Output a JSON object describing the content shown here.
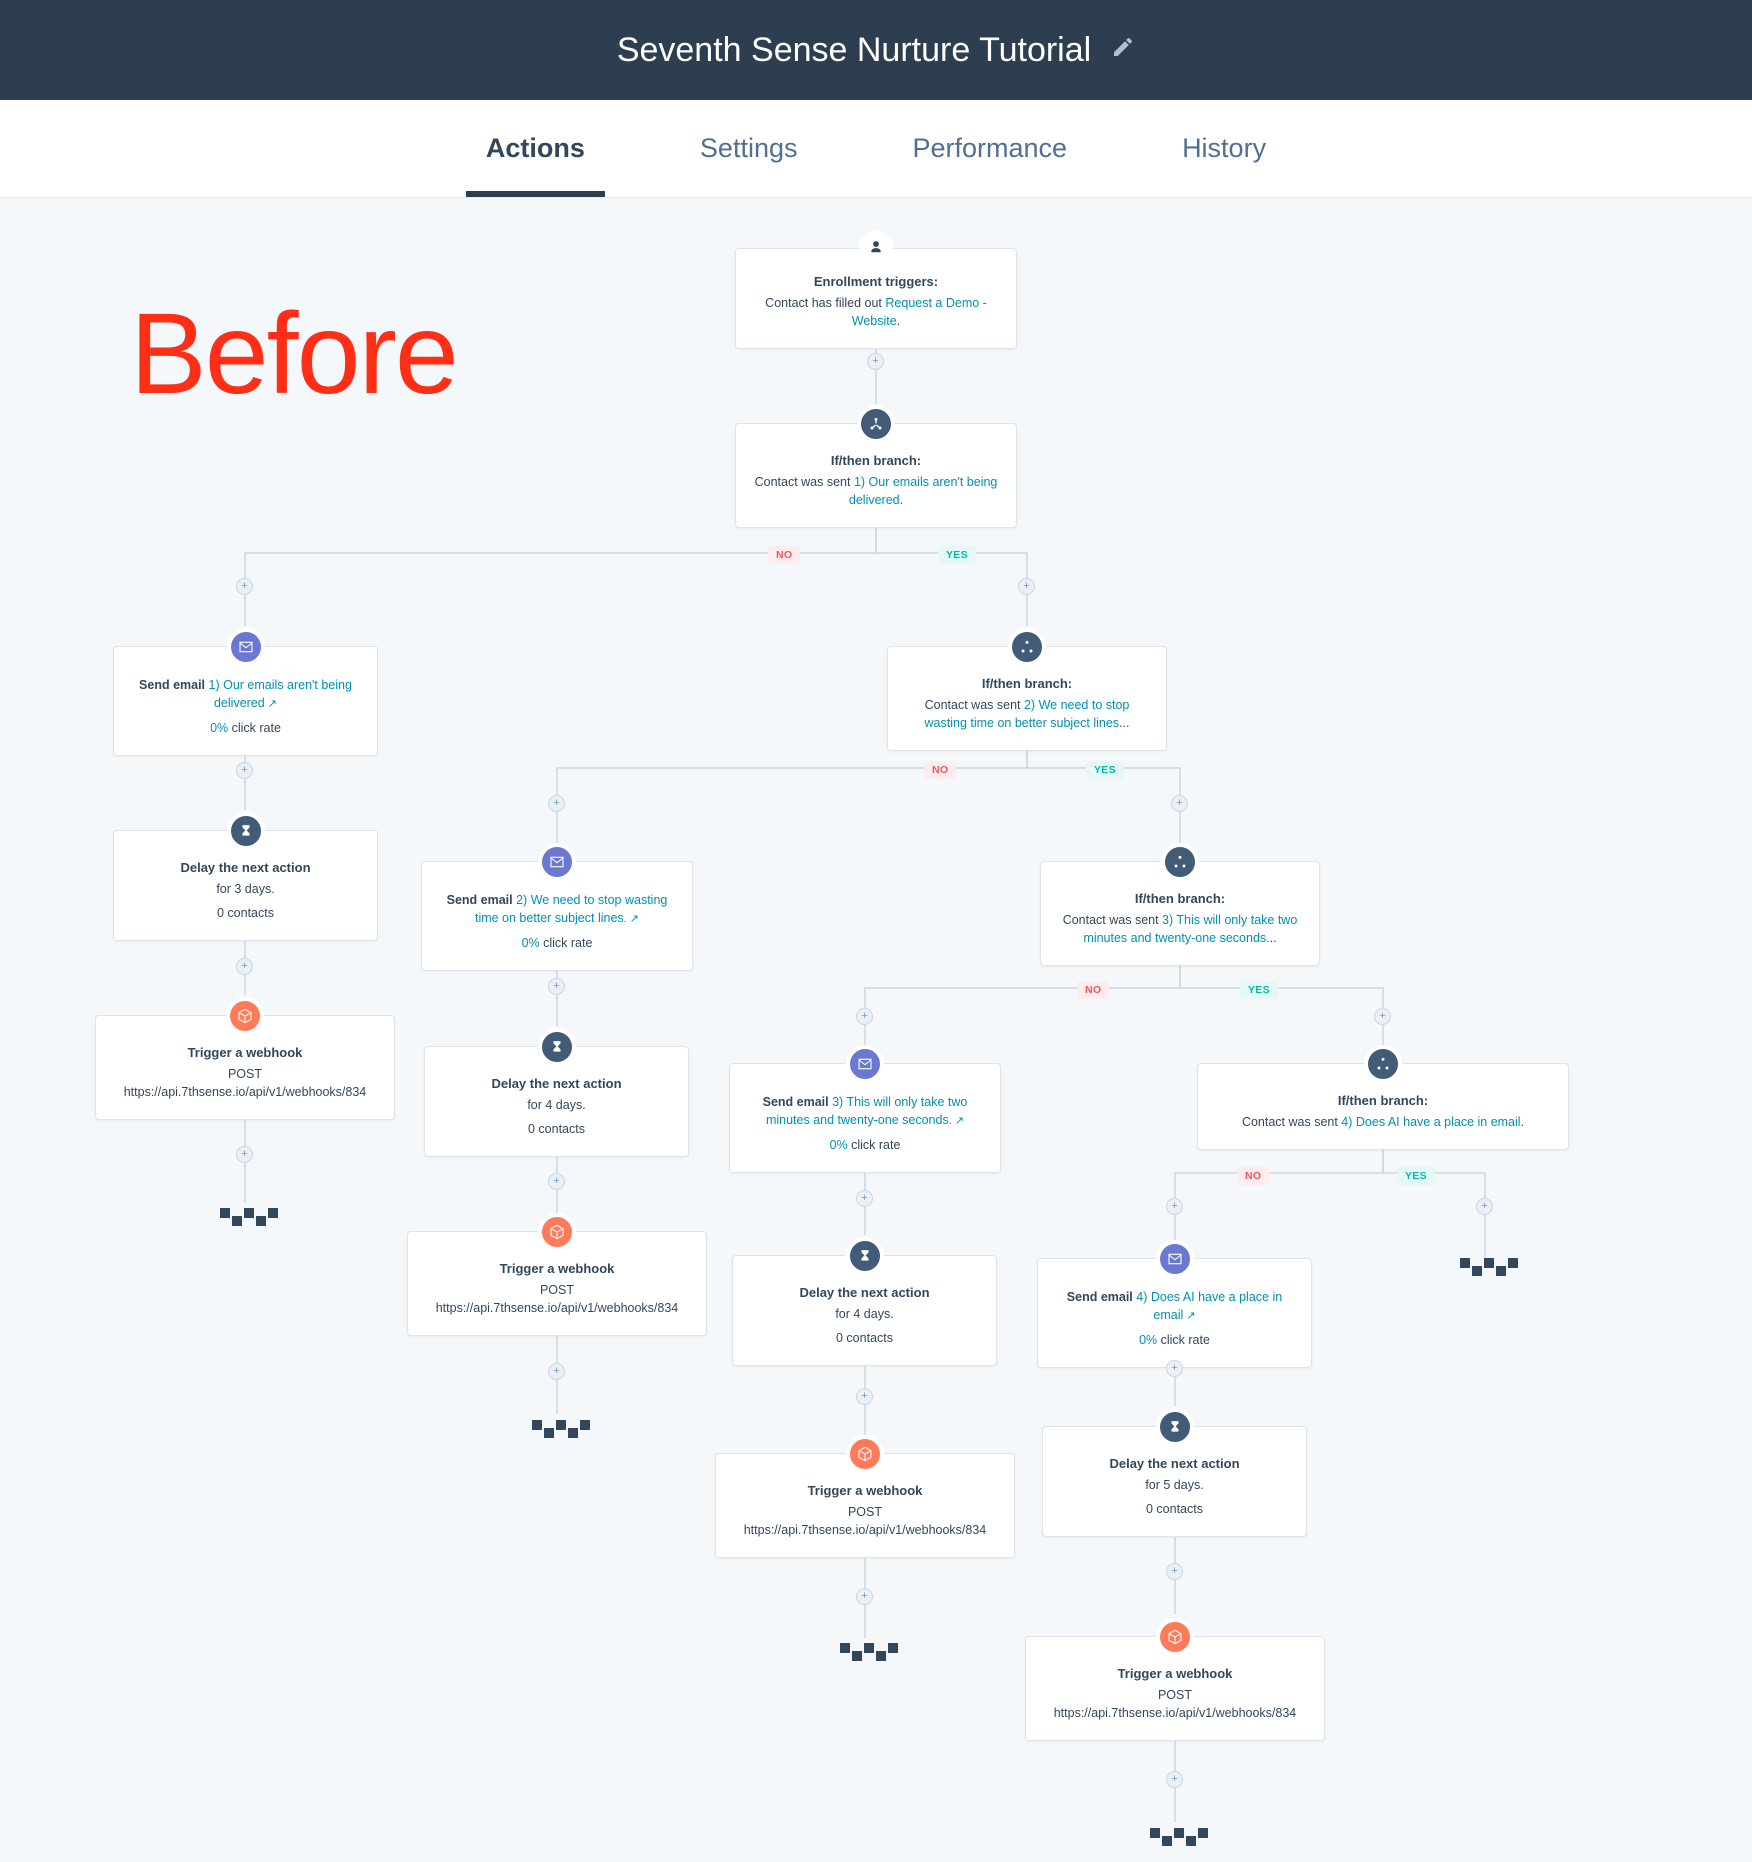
{
  "header": {
    "title": "Seventh Sense Nurture Tutorial"
  },
  "tabs": {
    "items": [
      "Actions",
      "Settings",
      "Performance",
      "History"
    ],
    "active": "Actions"
  },
  "labels": {
    "before": "Before",
    "no": "NO",
    "yes": "YES"
  },
  "common": {
    "enrollment_title": "Enrollment triggers:",
    "ifthen_title": "If/then branch:",
    "sent_prefix": "Contact was sent ",
    "send_email_prefix": "Send email ",
    "click_rate": " click rate",
    "zero_pct": "0%",
    "delay_title": "Delay the next action",
    "contacts_0": "0 contacts",
    "webhook_title": "Trigger a webhook",
    "post": "POST",
    "webhook_url": "https://api.7thsense.io/api/v1/webhooks/834",
    "filled_out_prefix": "Contact has filled out ",
    "filled_out_link": "Request a Demo - Website"
  },
  "emails": {
    "e1": "1) Our emails aren't being delivered",
    "e2": "2) We need to stop wasting time on better subject lines",
    "e3": "3) This will only take two minutes and twenty-one seconds",
    "e4": "4) Does AI have a place in email"
  },
  "branch_suffix": {
    "b1": ".",
    "b2": "...",
    "b3": "...",
    "b4": "."
  },
  "sendemail_suffix": {
    "s1": " ↗",
    "s2": ". ↗",
    "s3": ". ↗",
    "s4": " ↗"
  },
  "delays": {
    "d3": "for 3 days.",
    "d4": "for 4 days.",
    "d5": "for 5 days."
  }
}
